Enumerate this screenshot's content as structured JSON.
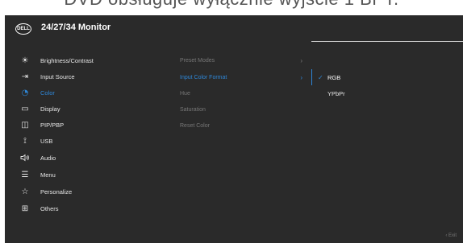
{
  "caption": "DVD obsługuje wyłącznie wyjście 1 BPT.",
  "header": {
    "logo": "DELL",
    "title": "24/27/34 Monitor"
  },
  "menu": [
    {
      "label": "Brightness/Contrast",
      "icon": "brightness-icon",
      "glyph": "☀"
    },
    {
      "label": "Input Source",
      "icon": "input-source-icon",
      "glyph": "⇥"
    },
    {
      "label": "Color",
      "icon": "color-icon",
      "glyph": "◔",
      "active": true
    },
    {
      "label": "Display",
      "icon": "display-icon",
      "glyph": "▭"
    },
    {
      "label": "PIP/PBP",
      "icon": "pip-icon",
      "glyph": "◫"
    },
    {
      "label": "USB",
      "icon": "usb-icon",
      "glyph": "⟟"
    },
    {
      "label": "Audio",
      "icon": "audio-icon",
      "glyph": "🔊"
    },
    {
      "label": "Menu",
      "icon": "menu-icon",
      "glyph": "☰"
    },
    {
      "label": "Personalize",
      "icon": "star-icon",
      "glyph": "☆"
    },
    {
      "label": "Others",
      "icon": "others-icon",
      "glyph": "⊞"
    }
  ],
  "submenu": [
    {
      "label": "Preset Modes",
      "chevron": "›"
    },
    {
      "label": "Input Color Format",
      "chevron": "›",
      "active": true
    },
    {
      "label": "Hue"
    },
    {
      "label": "Saturation"
    },
    {
      "label": "Reset Color"
    }
  ],
  "options": [
    {
      "label": "RGB",
      "selected": true,
      "check": "✓"
    },
    {
      "label": "YPbPr",
      "selected": false,
      "check": ""
    }
  ],
  "footer": {
    "exit_label": "‹  Exit"
  },
  "colors": {
    "accent": "#2e86d6",
    "background": "#2a2a2a"
  }
}
